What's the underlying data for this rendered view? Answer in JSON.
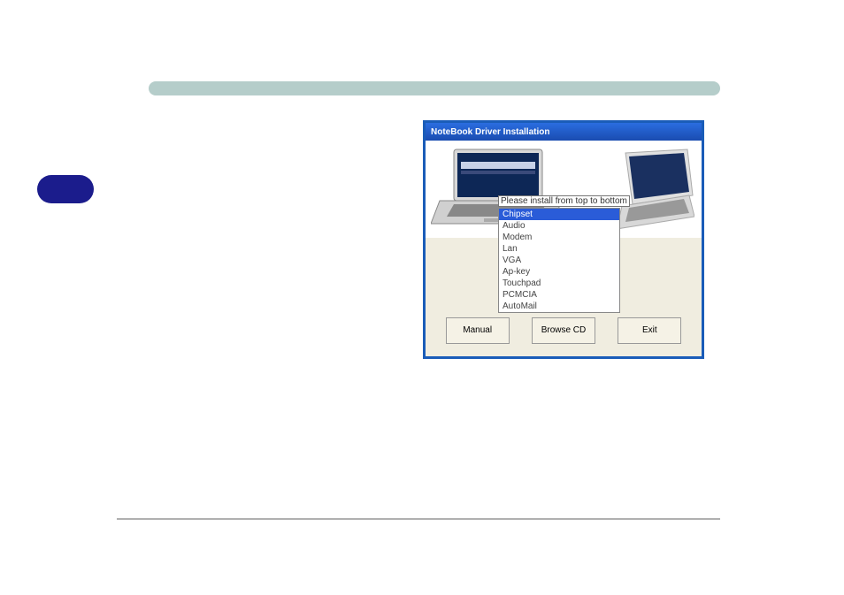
{
  "window": {
    "title": "NoteBook Driver Installation",
    "instruction": "Please install from top to bottom",
    "driver_list": [
      "Chipset",
      "Audio",
      "Modem",
      "Lan",
      "VGA",
      "Ap-key",
      "Touchpad",
      "PCMCIA",
      "AutoMail"
    ],
    "buttons": {
      "manual": "Manual",
      "browse": "Browse CD",
      "exit": "Exit"
    }
  }
}
